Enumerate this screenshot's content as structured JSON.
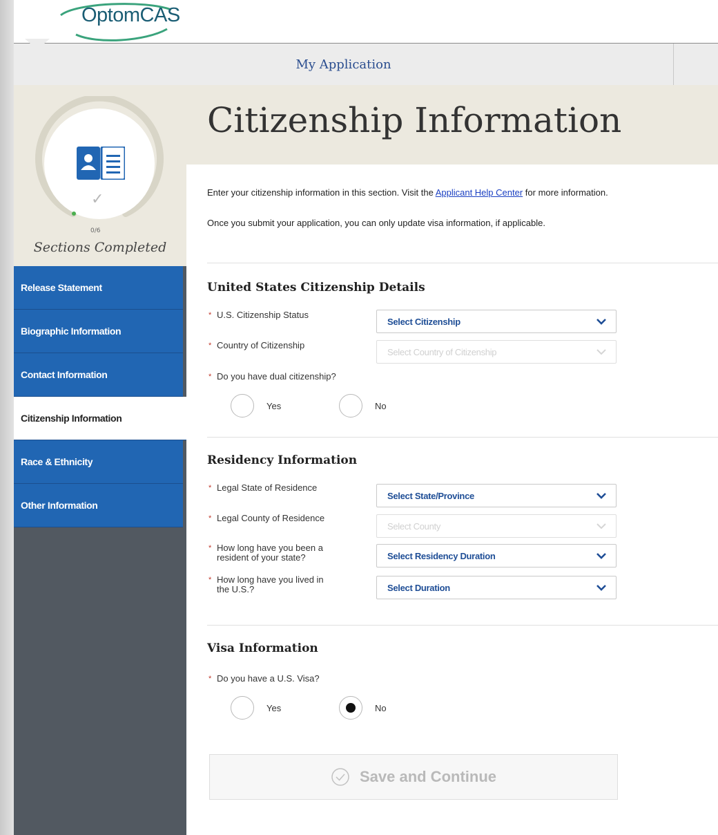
{
  "brand": {
    "logo_text": "OptomCAS"
  },
  "nav": {
    "tab_label": "My Application"
  },
  "progress": {
    "count": "0/6",
    "completed": 0,
    "total": 6,
    "label": "Sections Completed"
  },
  "sidebar": {
    "items": [
      {
        "label": "Release Statement"
      },
      {
        "label": "Biographic Information"
      },
      {
        "label": "Contact Information"
      },
      {
        "label": "Citizenship Information"
      },
      {
        "label": "Race & Ethnicity"
      },
      {
        "label": "Other Information"
      }
    ]
  },
  "page": {
    "title": "Citizenship Information",
    "intro_prefix": "Enter your citizenship information in this section. Visit the ",
    "intro_link": "Applicant Help Center",
    "intro_suffix": " for more information.",
    "intro_note": "Once you submit your application, you can only update visa information, if applicable."
  },
  "citizenship": {
    "title": "United States Citizenship Details",
    "status_label": "U.S. Citizenship Status",
    "status_value": "Select Citizenship",
    "country_label": "Country of Citizenship",
    "country_value": "Select Country of Citizenship",
    "dual_label": "Do you have dual citizenship?",
    "yes": "Yes",
    "no": "No"
  },
  "residency": {
    "title": "Residency Information",
    "state_label": "Legal State of Residence",
    "state_value": "Select State/Province",
    "county_label": "Legal County of Residence",
    "county_value": "Select County",
    "duration_label": "How long have you been a resident of your state?",
    "duration_value": "Select Residency Duration",
    "us_label": "How long have you lived in the U.S.?",
    "us_value": "Select Duration"
  },
  "visa": {
    "title": "Visa Information",
    "question": "Do you have a U.S. Visa?",
    "yes": "Yes",
    "no": "No"
  },
  "actions": {
    "save_label": "Save and Continue"
  },
  "colors": {
    "accent": "#2166b3",
    "brand": "#1a5d74",
    "required": "#c0392b"
  }
}
